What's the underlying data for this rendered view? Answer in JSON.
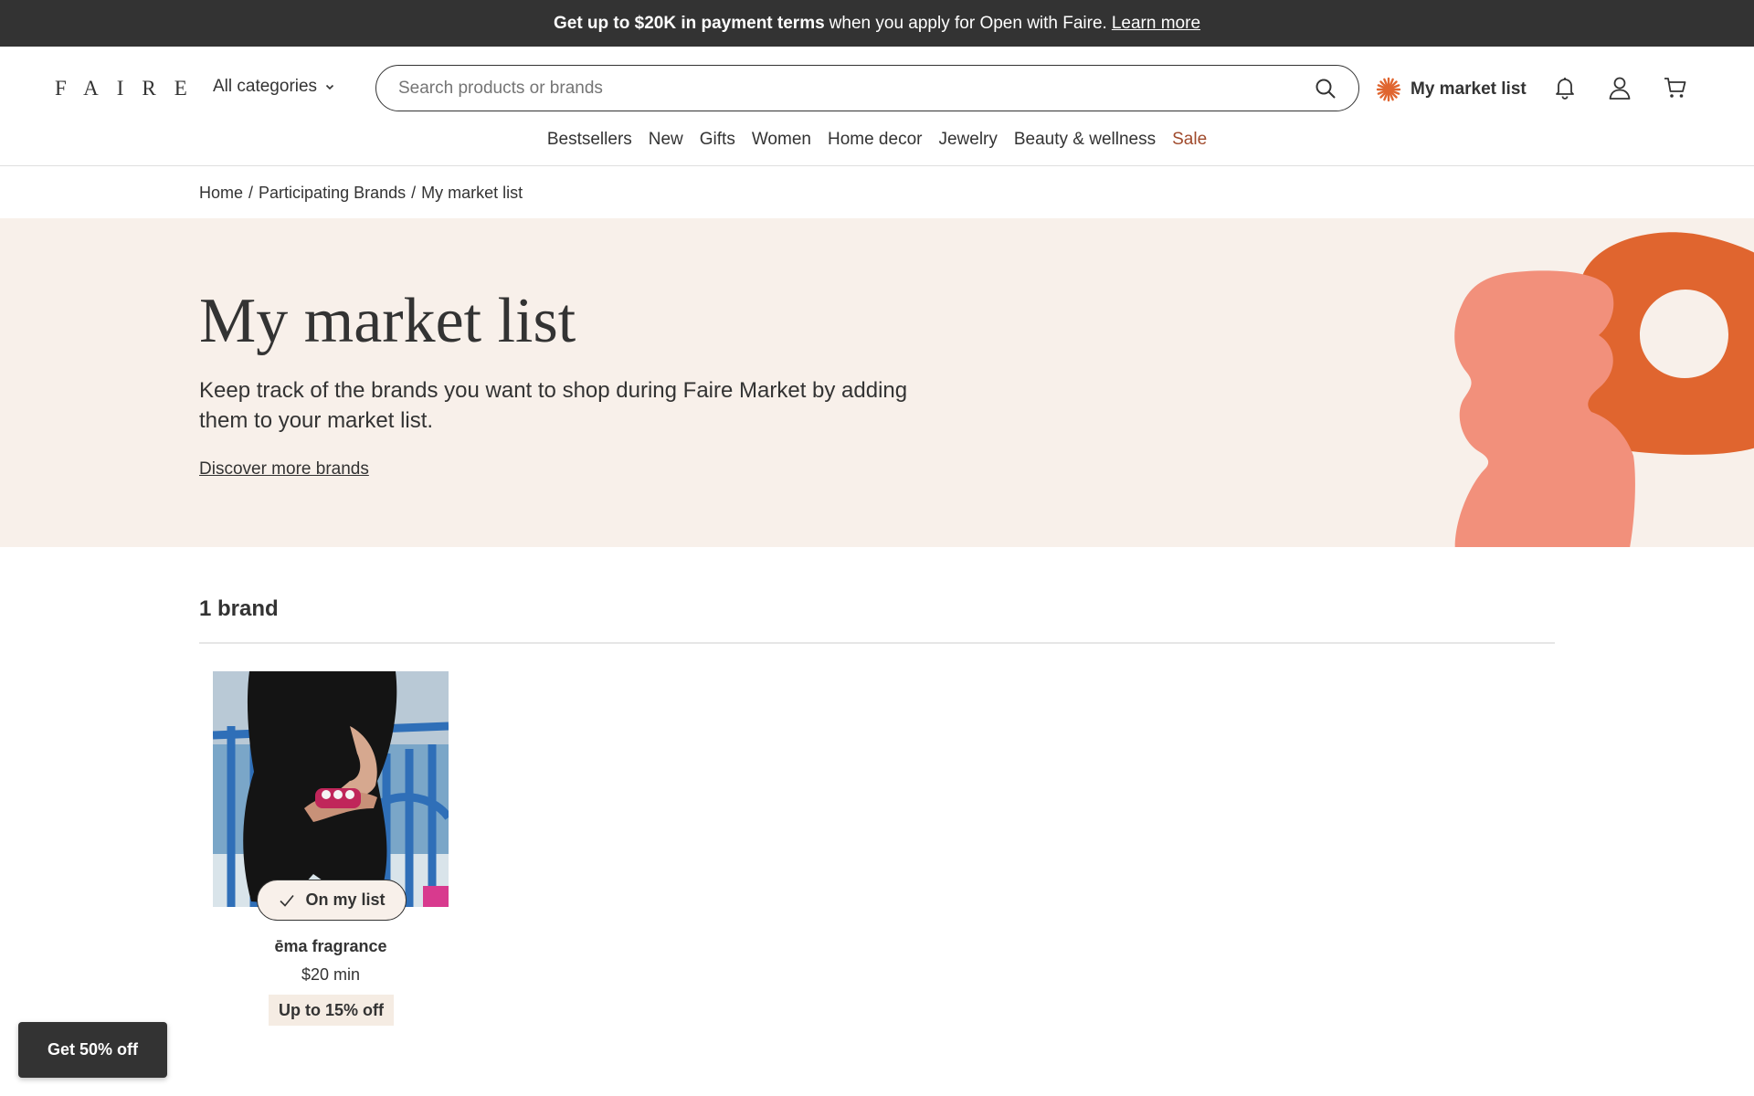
{
  "promo": {
    "bold": "Get up to $20K in payment terms",
    "text": "when you apply for Open with Faire.",
    "link": "Learn more"
  },
  "header": {
    "logo": "FAIRE",
    "categories": "All categories",
    "search_placeholder": "Search products or brands",
    "market_list": "My market list"
  },
  "nav": {
    "items": [
      "Bestsellers",
      "New",
      "Gifts",
      "Women",
      "Home decor",
      "Jewelry",
      "Beauty & wellness",
      "Sale"
    ]
  },
  "breadcrumb": {
    "items": [
      "Home",
      "Participating Brands",
      "My market list"
    ],
    "separator": "/"
  },
  "hero": {
    "title": "My market list",
    "description": "Keep track of the brands you want to shop during Faire Market by adding them to your market list.",
    "link": "Discover more brands"
  },
  "brands": {
    "count_label": "1 brand",
    "items": [
      {
        "on_list_label": "On my list",
        "name": "ēma fragrance",
        "minimum": "$20 min",
        "badge": "Up to 15% off"
      }
    ]
  },
  "cta": {
    "label": "Get 50% off"
  },
  "colors": {
    "banner_bg": "#333333",
    "hero_bg": "#f8f0ea",
    "accent_orange": "#e0652f",
    "accent_pink": "#f2907b",
    "sale": "#a04a2c"
  },
  "icons": [
    "chevron-down-icon",
    "search-icon",
    "sunburst-icon",
    "bell-icon",
    "user-icon",
    "cart-icon",
    "check-icon"
  ]
}
